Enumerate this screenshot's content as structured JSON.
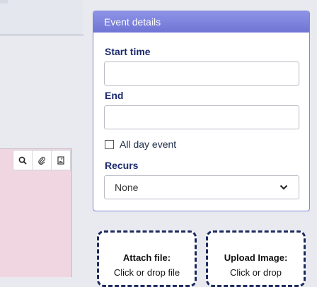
{
  "panel": {
    "title": "Event details",
    "start_label": "Start time",
    "start_value": "",
    "end_label": "End",
    "end_value": "",
    "allday_label": "All day event",
    "allday_checked": false,
    "recurs_label": "Recurs",
    "recurs_value": "None"
  },
  "toolbar": {
    "icons": [
      "search-icon",
      "paperclip-icon",
      "image-icon"
    ]
  },
  "dropzones": {
    "attach_title": "Attach file:",
    "attach_sub": "Click or drop file",
    "upload_title": "Upload Image:",
    "upload_sub": "Click or drop"
  },
  "colors": {
    "panel_header": "#7a80dc",
    "editor_bg": "#f0d6e0",
    "dropzone_border": "#1d2a5e"
  }
}
